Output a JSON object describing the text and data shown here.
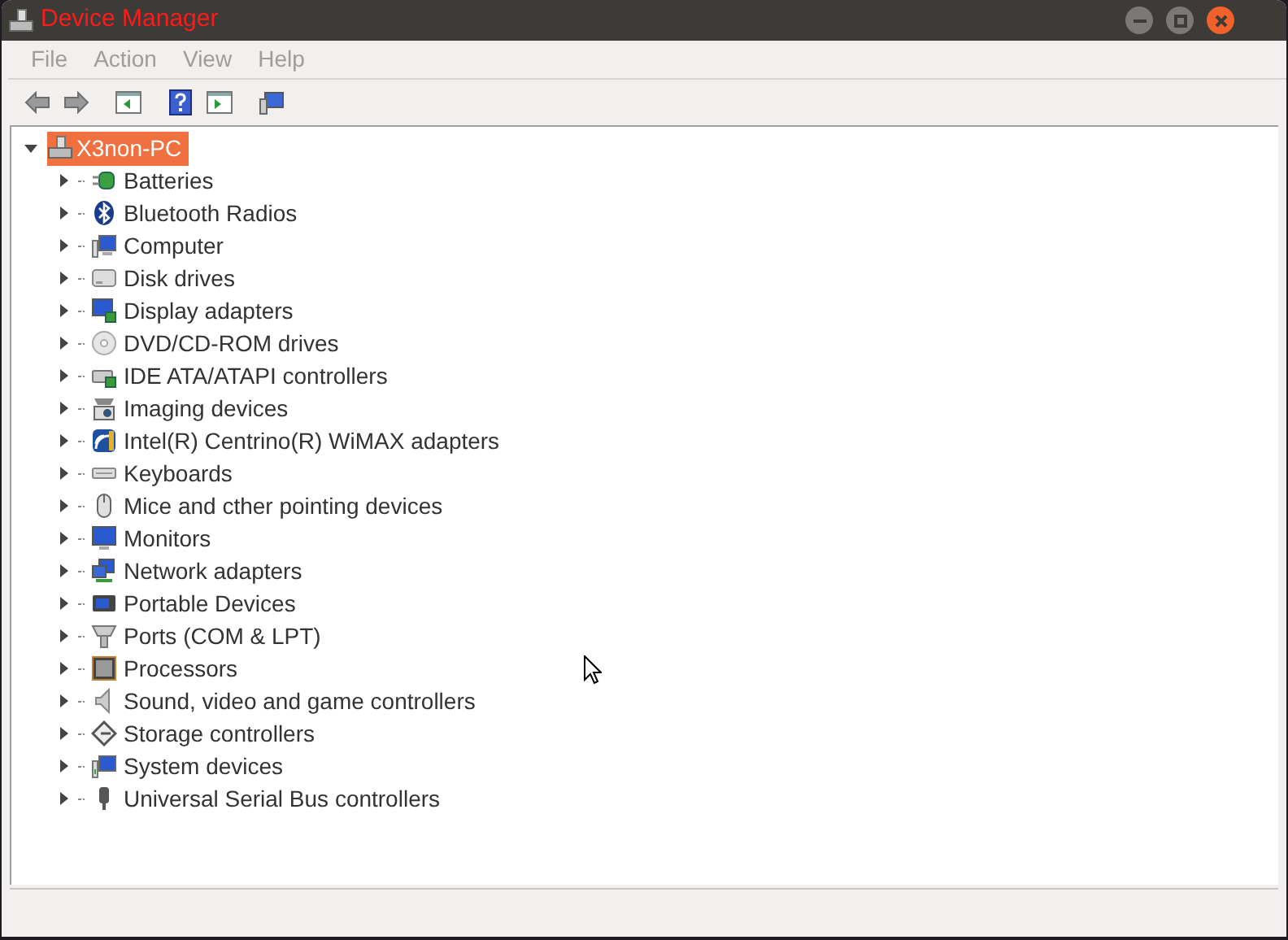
{
  "window": {
    "title": "Device Manager"
  },
  "menu": [
    "File",
    "Action",
    "View",
    "Help"
  ],
  "tree": {
    "label": "X3non-PC",
    "selected": true,
    "expanded": true,
    "children": [
      {
        "label": "Batteries",
        "expanded": false
      },
      {
        "label": "Bluetooth Radios",
        "expanded": false
      },
      {
        "label": "Computer",
        "expanded": false
      },
      {
        "label": "Disk drives",
        "expanded": false
      },
      {
        "label": "Display adapters",
        "expanded": false
      },
      {
        "label": "DVD/CD-ROM drives",
        "expanded": false
      },
      {
        "label": "IDE ATA/ATAPI controllers",
        "expanded": false
      },
      {
        "label": "Imaging devices",
        "expanded": false
      },
      {
        "label": "Intel(R) Centrino(R) WiMAX adapters",
        "expanded": false
      },
      {
        "label": "Keyboards",
        "expanded": false
      },
      {
        "label": "Mice and cther pointing devices",
        "expanded": false
      },
      {
        "label": "Monitors",
        "expanded": false
      },
      {
        "label": "Network adapters",
        "expanded": false
      },
      {
        "label": "Portable Devices",
        "expanded": false
      },
      {
        "label": "Ports (COM & LPT)",
        "expanded": false
      },
      {
        "label": "Processors",
        "expanded": false
      },
      {
        "label": "Sound, video and game controllers",
        "expanded": false
      },
      {
        "label": "Storage controllers",
        "expanded": false
      },
      {
        "label": "System devices",
        "expanded": false
      },
      {
        "label": "Universal Serial Bus controllers",
        "expanded": false
      }
    ]
  }
}
